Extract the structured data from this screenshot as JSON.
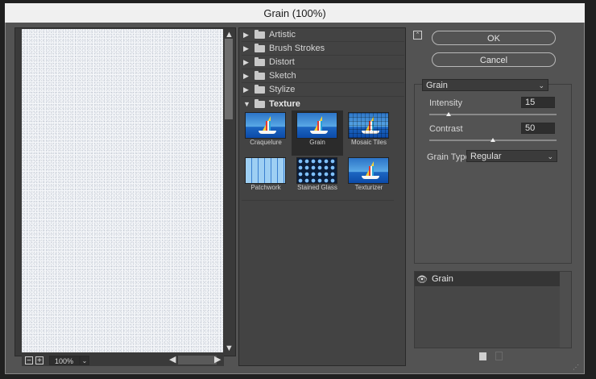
{
  "window": {
    "title": "Grain (100%)"
  },
  "preview": {
    "zoom": "100%",
    "zoom_out": "−",
    "zoom_in": "+"
  },
  "filter_gallery": {
    "categories": [
      {
        "label": "Artistic",
        "expanded": false
      },
      {
        "label": "Brush Strokes",
        "expanded": false
      },
      {
        "label": "Distort",
        "expanded": false
      },
      {
        "label": "Sketch",
        "expanded": false
      },
      {
        "label": "Stylize",
        "expanded": false
      },
      {
        "label": "Texture",
        "expanded": true
      }
    ],
    "texture_filters": [
      {
        "label": "Craquelure",
        "selected": false
      },
      {
        "label": "Grain",
        "selected": true
      },
      {
        "label": "Mosaic Tiles",
        "selected": false
      },
      {
        "label": "Patchwork",
        "selected": false
      },
      {
        "label": "Stained Glass",
        "selected": false
      },
      {
        "label": "Texturizer",
        "selected": false
      }
    ]
  },
  "buttons": {
    "ok": "OK",
    "cancel": "Cancel"
  },
  "settings": {
    "filter_select": "Grain",
    "intensity": {
      "label": "Intensity",
      "value": "15",
      "level": 0.15
    },
    "contrast": {
      "label": "Contrast",
      "value": "50",
      "level": 0.5
    },
    "grain_type": {
      "label": "Grain Type:",
      "value": "Regular"
    }
  },
  "layers": {
    "items": [
      {
        "label": "Grain",
        "visible": true
      }
    ]
  }
}
